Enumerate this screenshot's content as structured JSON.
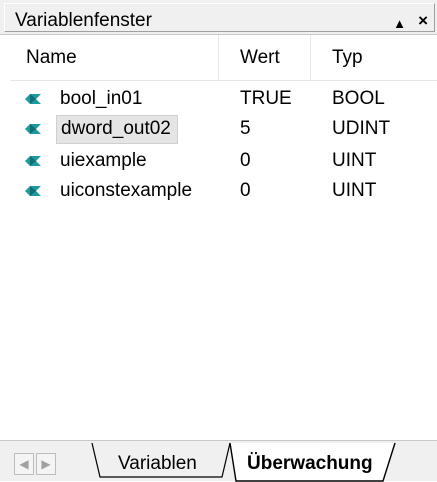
{
  "window": {
    "title": "Variablenfenster",
    "pin_glyph": "▲",
    "close_glyph": "×"
  },
  "columns": {
    "name": "Name",
    "value": "Wert",
    "type": "Typ"
  },
  "rows": [
    {
      "name": "bool_in01",
      "value": "TRUE",
      "type": "BOOL",
      "icon": "variable-icon",
      "selected": false
    },
    {
      "name": "dword_out02",
      "value": "5",
      "type": "UDINT",
      "icon": "variable-icon",
      "selected": true
    },
    {
      "name": "uiexample",
      "value": "0",
      "type": "UINT",
      "icon": "variable-icon",
      "selected": false
    },
    {
      "name": "uiconstexample",
      "value": "0",
      "type": "UINT",
      "icon": "variable-icon",
      "selected": false
    }
  ],
  "tabs": [
    {
      "label": "Variablen",
      "active": false
    },
    {
      "label": "Überwachung",
      "active": true
    }
  ],
  "scroll": {
    "left_glyph": "◀",
    "right_glyph": "▶"
  },
  "colors": {
    "icon_teal": "#1f9aa0",
    "selection_bg": "#e5e5e5",
    "chrome_bg": "#f0f0f0"
  }
}
